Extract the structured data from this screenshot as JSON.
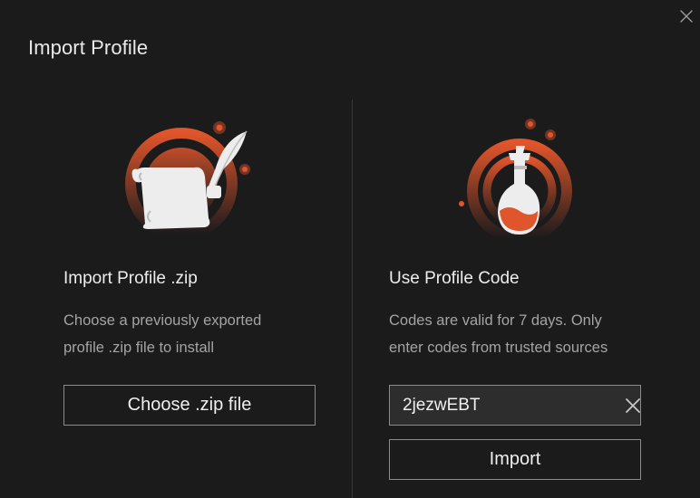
{
  "dialog": {
    "title": "Import Profile",
    "close_icon": "close-icon"
  },
  "zip_section": {
    "illustration_icon": "scroll-quill-icon",
    "heading": "Import Profile .zip",
    "description_line1": "Choose a previously exported",
    "description_line2": "profile .zip file to install",
    "button_label": "Choose .zip file"
  },
  "code_section": {
    "illustration_icon": "potion-flask-icon",
    "heading": "Use Profile Code",
    "description_line1": "Codes are valid for 7 days. Only",
    "description_line2": "enter codes from trusted sources",
    "input_value": "2jezwEBT",
    "clear_icon": "clear-x-icon",
    "button_label": "Import"
  },
  "colors": {
    "background": "#1b1b1c",
    "accent": "#e0552b",
    "input_background": "#2d2d2e",
    "border": "#8a8a8a"
  }
}
